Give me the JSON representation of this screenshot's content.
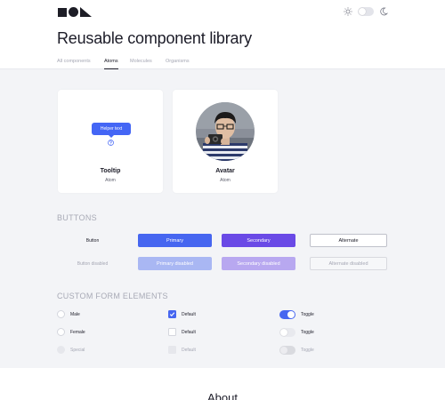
{
  "header": {
    "logo_icon": "logo-square-circle-triangle",
    "theme": {
      "light_icon": "sun-icon",
      "dark_icon": "moon-icon",
      "dark_mode": false
    }
  },
  "page": {
    "title": "Reusable component library"
  },
  "tabs": [
    {
      "label": "All components",
      "active": false
    },
    {
      "label": "Atoms",
      "active": true
    },
    {
      "label": "Molecules",
      "active": false
    },
    {
      "label": "Organisms",
      "active": false
    }
  ],
  "cards": {
    "tooltip": {
      "title": "Tooltip",
      "subtitle": "Atom",
      "bubble_text": "Helper text",
      "icon": "help-circle-icon"
    },
    "avatar": {
      "title": "Avatar",
      "subtitle": "Atom"
    }
  },
  "buttons_section": {
    "title": "BUTTONS",
    "row_default_label": "Button",
    "row_disabled_label": "Button disabled",
    "primary": "Primary",
    "secondary": "Secondary",
    "alternate": "Alternate",
    "primary_disabled": "Primary disabled",
    "secondary_disabled": "Secondary disabled",
    "alternate_disabled": "Alternate disabled"
  },
  "form_section": {
    "title": "CUSTOM FORM ELEMENTS",
    "radios": [
      {
        "label": "Male",
        "disabled": false
      },
      {
        "label": "Female",
        "disabled": false
      },
      {
        "label": "Special",
        "disabled": true
      }
    ],
    "checkboxes": [
      {
        "label": "Default",
        "checked": true,
        "disabled": false
      },
      {
        "label": "Default",
        "checked": false,
        "disabled": false
      },
      {
        "label": "Default",
        "checked": false,
        "disabled": true
      }
    ],
    "toggles": [
      {
        "label": "Toggle",
        "on": true,
        "disabled": false
      },
      {
        "label": "Toggle",
        "on": false,
        "disabled": false
      },
      {
        "label": "Toggle",
        "on": false,
        "disabled": true
      }
    ]
  },
  "about": {
    "title": "About"
  },
  "colors": {
    "primary": "#4666f0",
    "secondary": "#6a4ae6",
    "section_bg": "#f3f4f7",
    "text": "#1c1c28"
  }
}
